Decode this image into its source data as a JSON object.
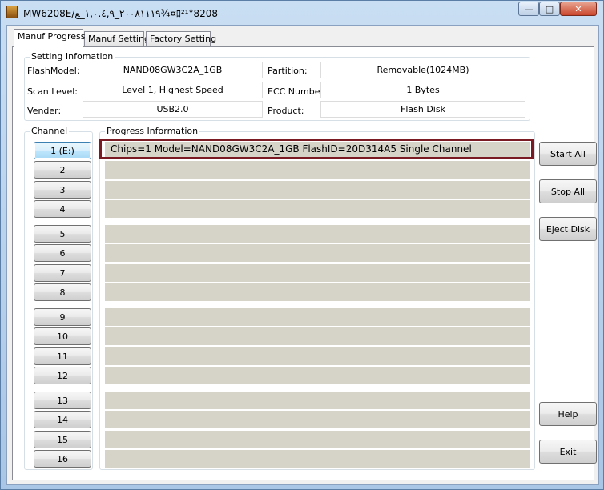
{
  "window": {
    "title": "MW6208E/٢٠٠٨١١١٩_١,٠.٤,٩_ﻊ¾¤ﾛ²¹°8208",
    "minimize_glyph": "—",
    "maximize_glyph": "□",
    "close_glyph": "✕"
  },
  "tabs": [
    {
      "label": "Manuf Progress"
    },
    {
      "label": "Manuf Setting"
    },
    {
      "label": "Factory Setting"
    }
  ],
  "setting_info": {
    "title": "Setting Infomation",
    "flash_model_label": "FlashModel:",
    "flash_model_value": "NAND08GW3C2A_1GB",
    "scan_level_label": "Scan Level:",
    "scan_level_value": "Level 1, Highest Speed",
    "vender_label": "Vender:",
    "vender_value": "USB2.0",
    "partition_label": "Partition:",
    "partition_value": "Removable(1024MB)",
    "ecc_label": "ECC Number:",
    "ecc_value": "1 Bytes",
    "product_label": "Product:",
    "product_value": "Flash Disk"
  },
  "channel": {
    "title": "Channel",
    "buttons": [
      "1 (E:)",
      "2",
      "3",
      "4",
      "5",
      "6",
      "7",
      "8",
      "9",
      "10",
      "11",
      "12",
      "13",
      "14",
      "15",
      "16"
    ]
  },
  "progress": {
    "title": "Progress Information",
    "row1_text": "Chips=1 Model=NAND08GW3C2A_1GB FlashID=20D314A5 Single Channel"
  },
  "actions": {
    "start_all": "Start All",
    "stop_all": "Stop All",
    "eject_disk": "Eject Disk",
    "help": "Help",
    "exit": "Exit"
  },
  "colors": {
    "progress_row": "#d6d3c8",
    "highlight_border": "#7a1a22"
  }
}
